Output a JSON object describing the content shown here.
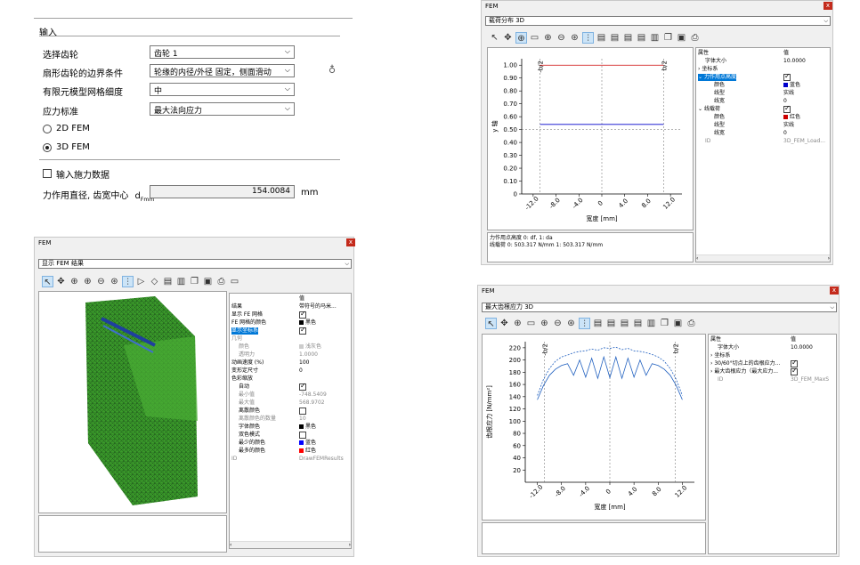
{
  "input_panel": {
    "section_title": "输入",
    "select_gear_label": "选择齿轮",
    "select_gear_value": "齿轮 1",
    "boundary_label": "扇形齿轮的边界条件",
    "boundary_value": "轮缘的内径/外径 固定，侧面滑动",
    "mesh_label": "有限元模型网格细度",
    "mesh_value": "中",
    "stress_label": "应力标准",
    "stress_value": "最大法向应力",
    "fem2d_label": "2D FEM",
    "fem3d_label": "3D FEM",
    "load_data_label": "输入施力数据",
    "diameter_label": "力作用直径, 齿宽中心",
    "diameter_symbol": "d",
    "diameter_subscript": "Fmm",
    "diameter_value": "154.0084",
    "diameter_unit": "mm"
  },
  "win_fem_results": {
    "title": "FEM",
    "close": "x",
    "combo": "显示 FEM 结果",
    "props_header": "值",
    "props": [
      {
        "k": "结果",
        "v": "带符号的马米..."
      },
      {
        "k": "显示 FE 网格",
        "v": "",
        "chk": true
      },
      {
        "k": "FE 网格的颜色",
        "v": "黑色",
        "color": "#000000"
      },
      {
        "k": "显示坐标系",
        "v": "",
        "chk": true,
        "hl": true
      },
      {
        "k": "几何",
        "v": "",
        "gray": true
      },
      {
        "k": "颜色",
        "v": "浅灰色",
        "gray": true,
        "indent": true,
        "color": "#cccccc"
      },
      {
        "k": "透明力",
        "v": "1.0000",
        "gray": true,
        "indent": true
      },
      {
        "k": "动画速度 (%)",
        "v": "100"
      },
      {
        "k": "变形定尺寸",
        "v": "0"
      },
      {
        "k": "色彩缩放",
        "v": ""
      },
      {
        "k": "自动",
        "v": "",
        "chk": true,
        "indent": true
      },
      {
        "k": "最小值",
        "v": "-748.5409",
        "gray": true,
        "indent": true
      },
      {
        "k": "最大值",
        "v": "568.9702",
        "gray": true,
        "indent": true
      },
      {
        "k": "离散颜色",
        "v": "",
        "chk": false,
        "indent": true
      },
      {
        "k": "离散颜色的数量",
        "v": "10",
        "gray": true,
        "indent": true
      },
      {
        "k": "字体颜色",
        "v": "黑色",
        "indent": true,
        "color": "#000000"
      },
      {
        "k": "双色模式",
        "v": "",
        "chk": false,
        "indent": true
      },
      {
        "k": "最少的颜色",
        "v": "蓝色",
        "indent": true,
        "color": "#0000ff"
      },
      {
        "k": "最多的颜色",
        "v": "红色",
        "indent": true,
        "color": "#ff0000"
      },
      {
        "k": "ID",
        "v": "DrawFEMResults",
        "gray": true
      }
    ]
  },
  "win_load": {
    "title": "FEM",
    "close": "x",
    "combo": "载荷分布 3D",
    "info_line1": "力作用点高度 0: df, 1: da",
    "info_line2": "线载荷 0: 503.317 N/mm 1: 503.317 N/mm",
    "props_col1": "属性",
    "props_col2": "值",
    "props": [
      {
        "k": "字体大小",
        "v": "10.0000",
        "indent": true
      },
      {
        "k": "坐标系",
        "v": "",
        "expander": "›"
      },
      {
        "k": "力作用点高度",
        "v": "",
        "chk": true,
        "expander": "⌄",
        "hl": true
      },
      {
        "k": "颜色",
        "v": "蓝色",
        "indent2": true,
        "color": "#0000cc"
      },
      {
        "k": "线型",
        "v": "实线",
        "indent2": true
      },
      {
        "k": "线宽",
        "v": "0",
        "indent2": true
      },
      {
        "k": "线载荷",
        "v": "",
        "chk": true,
        "expander": "⌄"
      },
      {
        "k": "颜色",
        "v": "红色",
        "indent2": true,
        "color": "#cc0000"
      },
      {
        "k": "线型",
        "v": "实线",
        "indent2": true
      },
      {
        "k": "线宽",
        "v": "0",
        "indent2": true
      },
      {
        "k": "ID",
        "v": "3D_FEM_Load...",
        "gray": true,
        "indent": true
      }
    ]
  },
  "win_stress": {
    "title": "FEM",
    "close": "x",
    "combo": "最大齿根应力 3D",
    "props_col1": "属性",
    "props_col2": "值",
    "props": [
      {
        "k": "字体大小",
        "v": "10.0000",
        "indent": true
      },
      {
        "k": "坐标系",
        "v": "",
        "expander": "›"
      },
      {
        "k": "30/60°切点上的齿根应力...",
        "v": "",
        "chk": true,
        "expander": "›"
      },
      {
        "k": "最大齿根应力（最大应力...",
        "v": "",
        "chk": true,
        "expander": "›"
      },
      {
        "k": "ID",
        "v": "3D_FEM_MaxS",
        "gray": true,
        "indent": true
      }
    ]
  },
  "chart_data": [
    {
      "type": "line",
      "xlabel": "宽度 [mm]",
      "ylabel": "y 轴",
      "xticks": [
        "-12.0",
        "-8.0",
        "-4.0",
        "0",
        "4.0",
        "8.0",
        "12.0"
      ],
      "yticks": [
        "0",
        "0.10",
        "0.20",
        "0.30",
        "0.40",
        "0.50",
        "0.60",
        "0.70",
        "0.80",
        "0.90",
        "1.00"
      ],
      "xlim": [
        -14,
        14
      ],
      "ylim": [
        0,
        1.05
      ],
      "annotations": [
        "-b/2",
        "b/2"
      ],
      "series": [
        {
          "color": "#cc0000",
          "x": [
            -10.8,
            10.8
          ],
          "y": [
            1.0,
            1.0
          ]
        },
        {
          "color": "#0000cc",
          "x": [
            -10.8,
            10.8
          ],
          "y": [
            0.54,
            0.54
          ]
        }
      ],
      "hlines": [
        0.5
      ],
      "vlines": [
        -10.8,
        0,
        10.8
      ]
    },
    {
      "type": "line",
      "xlabel": "宽度 [mm]",
      "ylabel": "齿根应力 [N/mm²]",
      "xticks": [
        "-12.0",
        "-8.0",
        "-4.0",
        "0",
        "4.0",
        "8.0",
        "12.0"
      ],
      "yticks": [
        "20",
        "40",
        "60",
        "80",
        "100",
        "120",
        "140",
        "160",
        "180",
        "200",
        "220"
      ],
      "xlim": [
        -14,
        14
      ],
      "ylim": [
        0,
        230
      ],
      "annotations": [
        "-b/2",
        "b/2"
      ],
      "series": [
        {
          "color": "#1f5fbf",
          "dash": true,
          "x": [
            -12,
            -11,
            -10,
            -9,
            -8,
            -7,
            -6,
            -5,
            -4,
            -3,
            -2,
            -1,
            0,
            1,
            2,
            3,
            4,
            5,
            6,
            7,
            8,
            9,
            10,
            11,
            12
          ],
          "y": [
            142,
            168,
            186,
            198,
            205,
            208,
            212,
            214,
            215,
            218,
            216,
            220,
            219,
            221,
            217,
            219,
            215,
            214,
            212,
            209,
            205,
            198,
            186,
            168,
            142
          ]
        },
        {
          "color": "#1f5fbf",
          "dash": false,
          "x": [
            -12,
            -11,
            -10,
            -9,
            -8,
            -7,
            -6,
            -5,
            -4,
            -3,
            -2,
            -1,
            0,
            1,
            2,
            3,
            4,
            5,
            6,
            7,
            8,
            9,
            10,
            11,
            12
          ],
          "y": [
            135,
            158,
            175,
            185,
            191,
            194,
            175,
            200,
            172,
            203,
            170,
            205,
            171,
            205,
            170,
            203,
            172,
            200,
            175,
            194,
            191,
            185,
            175,
            158,
            135
          ]
        }
      ],
      "vlines": [
        -10.8,
        0,
        10.8
      ]
    }
  ]
}
